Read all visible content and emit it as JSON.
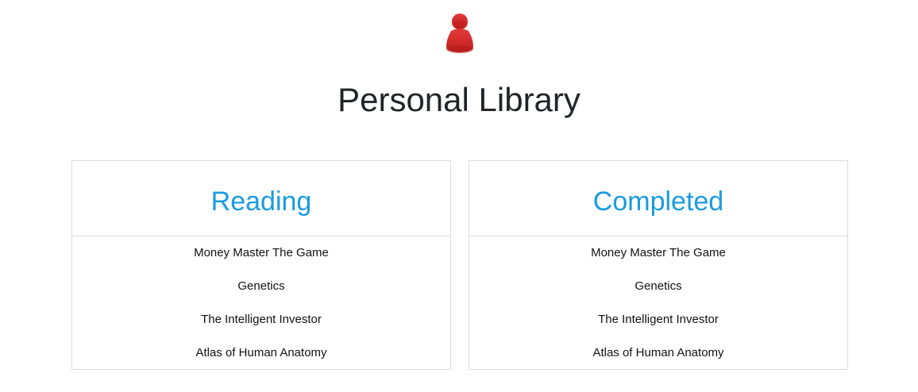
{
  "app": {
    "logo_icon": "pawn-person-icon",
    "title": "Personal Library"
  },
  "colors": {
    "accent": "#1a9be0",
    "logo": "#d32a2a",
    "border": "#dcdcdc"
  },
  "panels": [
    {
      "title": "Reading",
      "books": [
        "Money Master The Game",
        "Genetics",
        "The Intelligent Investor",
        "Atlas of Human Anatomy"
      ]
    },
    {
      "title": "Completed",
      "books": [
        "Money Master The Game",
        "Genetics",
        "The Intelligent Investor",
        "Atlas of Human Anatomy"
      ]
    }
  ]
}
